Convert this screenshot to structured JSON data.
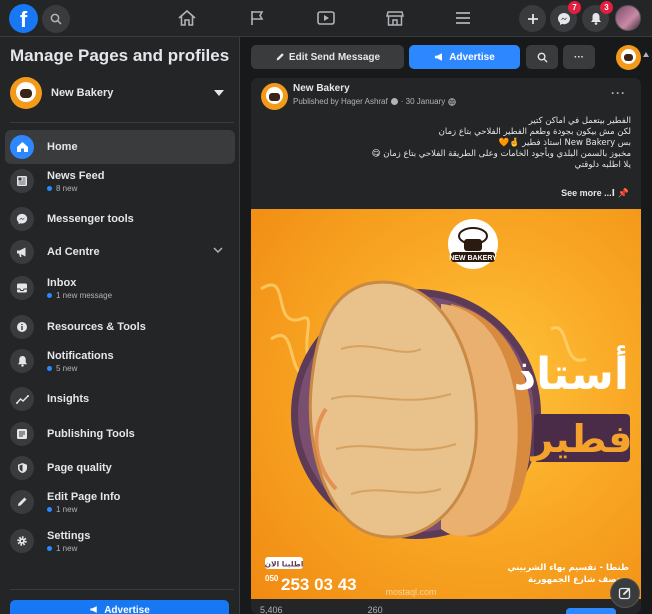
{
  "topbar": {
    "logo_letter": "f",
    "messenger_badge": "7",
    "notifications_badge": "3"
  },
  "sidebar": {
    "title": "Manage Pages and profiles",
    "page_name": "New Bakery",
    "items": [
      {
        "label": "Home",
        "sub": ""
      },
      {
        "label": "News Feed",
        "sub": "8 new"
      },
      {
        "label": "Messenger tools",
        "sub": ""
      },
      {
        "label": "Ad Centre",
        "sub": ""
      },
      {
        "label": "Inbox",
        "sub": "1 new message"
      },
      {
        "label": "Resources & Tools",
        "sub": ""
      },
      {
        "label": "Notifications",
        "sub": "5 new"
      },
      {
        "label": "Insights",
        "sub": ""
      },
      {
        "label": "Publishing Tools",
        "sub": ""
      },
      {
        "label": "Page quality",
        "sub": ""
      },
      {
        "label": "Edit Page Info",
        "sub": "1 new"
      },
      {
        "label": "Settings",
        "sub": "1 new"
      }
    ],
    "advertise_label": "Advertise"
  },
  "actions": {
    "edit_send_message": "Edit Send Message",
    "advertise": "Advertise",
    "more": "···"
  },
  "post": {
    "page_name": "New Bakery",
    "published_by": "Published by Hager Ashraf",
    "date": "30 January",
    "more": "···",
    "lines": [
      "الفطير بيتعمل في اماكن كتير",
      "لكن مش بيكون بجودة وطعم الفطير الفلاحي بتاع زمان",
      "بس New Bakery استاذ فطير 🤞🧡",
      "مخبوز بالسمن البلدي وبأجود الخامات وعلى الطريقة الفلاحي بتاع زمان 😋",
      "يلا اطلبه دلوقتي"
    ],
    "see_more": "See more ...ا",
    "image": {
      "brand": "NEW BAKERY",
      "headline_1": "أستاذ",
      "headline_2": "فطير",
      "order_now": "اطلبنا الان",
      "phone_prefix": "050",
      "phone": "253 03 43",
      "address_1": "طنطا - تقسيم بهاء الشربيني",
      "address_2": "منتصف شارع الجمهورية",
      "watermark": "mostaql.com"
    },
    "stats": {
      "likes": "5,406",
      "comments": "260"
    }
  },
  "colors": {
    "accent": "#2d88ff",
    "brand_blue": "#1877f2",
    "badge_red": "#e41e3f",
    "bakery_orange": "#f39a1b"
  }
}
